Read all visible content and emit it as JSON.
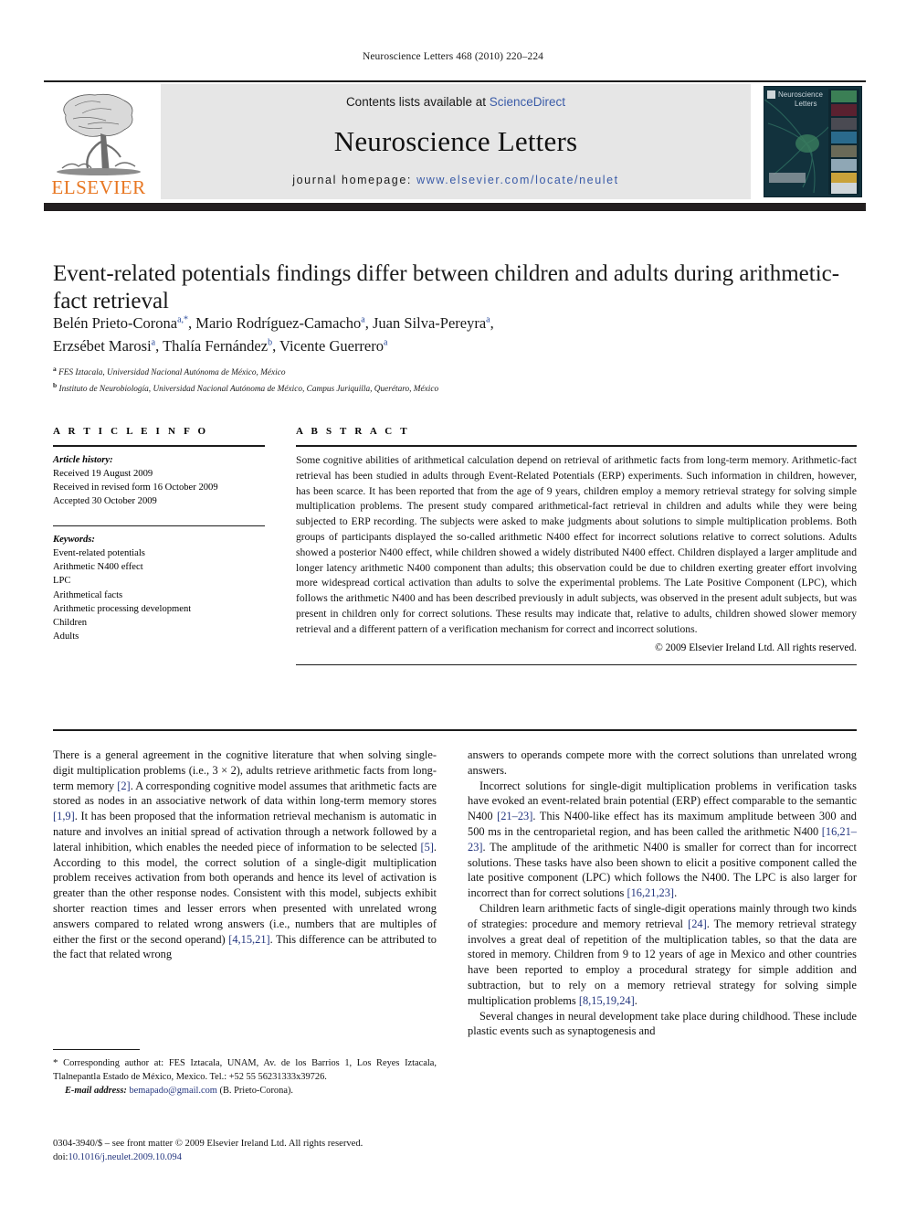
{
  "running_head": "Neuroscience Letters 468 (2010) 220–224",
  "header": {
    "publisher_wordmark": "ELSEVIER",
    "contents_prefix": "Contents lists available at ",
    "contents_link": "ScienceDirect",
    "journal_title": "Neuroscience Letters",
    "homepage_prefix": "journal homepage: ",
    "homepage_url": "www.elsevier.com/locate/neulet",
    "cover_title_line1": "Neuroscience",
    "cover_title_line2": "Letters",
    "link_color": "#3b5ca8",
    "elsevier_orange": "#E87722",
    "panel_gray": "#e6e6e6"
  },
  "article": {
    "title": "Event-related potentials findings differ between children and adults during arithmetic-fact retrieval",
    "authors_line1_pre": "Belén Prieto-Corona",
    "authors_line1_mid1": ", Mario Rodríguez-Camacho",
    "authors_line1_mid2": ", Juan Silva-Pereyra",
    "authors_line2_pre": "Erzsébet Marosi",
    "authors_line2_mid1": ", Thalía Fernández",
    "authors_line2_mid2": ", Vicente Guerrero",
    "affiliation_a": "FES Iztacala, Universidad Nacional Autónoma de México, México",
    "affiliation_b": "Instituto de Neurobiología, Universidad Nacional Autónoma de México, Campus Juriquilla, Querétaro, México"
  },
  "article_info": {
    "heading": "A R T I C L E  I N F O",
    "history_label": "Article history:",
    "history": [
      "Received 19 August 2009",
      "Received in revised form 16 October 2009",
      "Accepted 30 October 2009"
    ],
    "keywords_label": "Keywords:",
    "keywords": [
      "Event-related potentials",
      "Arithmetic N400 effect",
      "LPC",
      "Arithmetical facts",
      "Arithmetic processing development",
      "Children",
      "Adults"
    ]
  },
  "abstract": {
    "heading": "A B S T R A C T",
    "text": "Some cognitive abilities of arithmetical calculation depend on retrieval of arithmetic facts from long-term memory. Arithmetic-fact retrieval has been studied in adults through Event-Related Potentials (ERP) experiments. Such information in children, however, has been scarce. It has been reported that from the age of 9 years, children employ a memory retrieval strategy for solving simple multiplication problems. The present study compared arithmetical-fact retrieval in children and adults while they were being subjected to ERP recording. The subjects were asked to make judgments about solutions to simple multiplication problems. Both groups of participants displayed the so-called arithmetic N400 effect for incorrect solutions relative to correct solutions. Adults showed a posterior N400 effect, while children showed a widely distributed N400 effect. Children displayed a larger amplitude and longer latency arithmetic N400 component than adults; this observation could be due to children exerting greater effort involving more widespread cortical activation than adults to solve the experimental problems. The Late Positive Component (LPC), which follows the arithmetic N400 and has been described previously in adult subjects, was observed in the present adult subjects, but was present in children only for correct solutions. These results may indicate that, relative to adults, children showed slower memory retrieval and a different pattern of a verification mechanism for correct and incorrect solutions.",
    "copyright": "© 2009 Elsevier Ireland Ltd. All rights reserved."
  },
  "body": {
    "left": [
      {
        "indent": false,
        "parts": [
          {
            "t": "There is a general agreement in the cognitive literature that when solving single-digit multiplication problems (i.e., 3 × 2), adults retrieve arithmetic facts from long-term memory ",
            "ref": false
          },
          {
            "t": "[2]",
            "ref": true
          },
          {
            "t": ". A corresponding cognitive model assumes that arithmetic facts are stored as nodes in an associative network of data within long-term memory stores ",
            "ref": false
          },
          {
            "t": "[1,9]",
            "ref": true
          },
          {
            "t": ". It has been proposed that the information retrieval mechanism is automatic in nature and involves an initial spread of activation through a network followed by a lateral inhibition, which enables the needed piece of information to be selected ",
            "ref": false
          },
          {
            "t": "[5]",
            "ref": true
          },
          {
            "t": ". According to this model, the correct solution of a single-digit multiplication problem receives activation from both operands and hence its level of activation is greater than the other response nodes. Consistent with this model, subjects exhibit shorter reaction times and lesser errors when presented with unrelated wrong answers compared to related wrong answers (i.e., numbers that are multiples of either the first or the second operand) ",
            "ref": false
          },
          {
            "t": "[4,15,21]",
            "ref": true
          },
          {
            "t": ". This difference can be attributed to the fact that related wrong",
            "ref": false
          }
        ]
      }
    ],
    "right": [
      {
        "indent": false,
        "parts": [
          {
            "t": "answers to operands compete more with the correct solutions than unrelated wrong answers.",
            "ref": false
          }
        ]
      },
      {
        "indent": true,
        "parts": [
          {
            "t": "Incorrect solutions for single-digit multiplication problems in verification tasks have evoked an event-related brain potential (ERP) effect comparable to the semantic N400 ",
            "ref": false
          },
          {
            "t": "[21–23]",
            "ref": true
          },
          {
            "t": ". This N400-like effect has its maximum amplitude between 300 and 500 ms in the centroparietal region, and has been called the arithmetic N400 ",
            "ref": false
          },
          {
            "t": "[16,21–23]",
            "ref": true
          },
          {
            "t": ". The amplitude of the arithmetic N400 is smaller for correct than for incorrect solutions. These tasks have also been shown to elicit a positive component called the late positive component (LPC) which follows the N400. The LPC is also larger for incorrect than for correct solutions ",
            "ref": false
          },
          {
            "t": "[16,21,23]",
            "ref": true
          },
          {
            "t": ".",
            "ref": false
          }
        ]
      },
      {
        "indent": true,
        "parts": [
          {
            "t": "Children learn arithmetic facts of single-digit operations mainly through two kinds of strategies: procedure and memory retrieval ",
            "ref": false
          },
          {
            "t": "[24]",
            "ref": true
          },
          {
            "t": ". The memory retrieval strategy involves a great deal of repetition of the multiplication tables, so that the data are stored in memory. Children from 9 to 12 years of age in Mexico and other countries have been reported to employ a procedural strategy for simple addition and subtraction, but to rely on a memory retrieval strategy for solving simple multiplication problems ",
            "ref": false
          },
          {
            "t": "[8,15,19,24]",
            "ref": true
          },
          {
            "t": ".",
            "ref": false
          }
        ]
      },
      {
        "indent": true,
        "parts": [
          {
            "t": "Several changes in neural development take place during childhood. These include plastic events such as synaptogenesis and",
            "ref": false
          }
        ]
      }
    ]
  },
  "footnotes": {
    "corresponding_star": "*",
    "corresponding_text": "Corresponding author at: FES Iztacala, UNAM, Av. de los Barrios 1, Los Reyes Iztacala, Tlalnepantla Estado de México, Mexico. Tel.: +52 55 56231333x39726.",
    "email_label": "E-mail address:",
    "email": "bemapado@gmail.com",
    "email_owner": "(B. Prieto-Corona).",
    "issn_line": "0304-3940/$ – see front matter © 2009 Elsevier Ireland Ltd. All rights reserved.",
    "doi_label": "doi:",
    "doi": "10.1016/j.neulet.2009.10.094"
  }
}
